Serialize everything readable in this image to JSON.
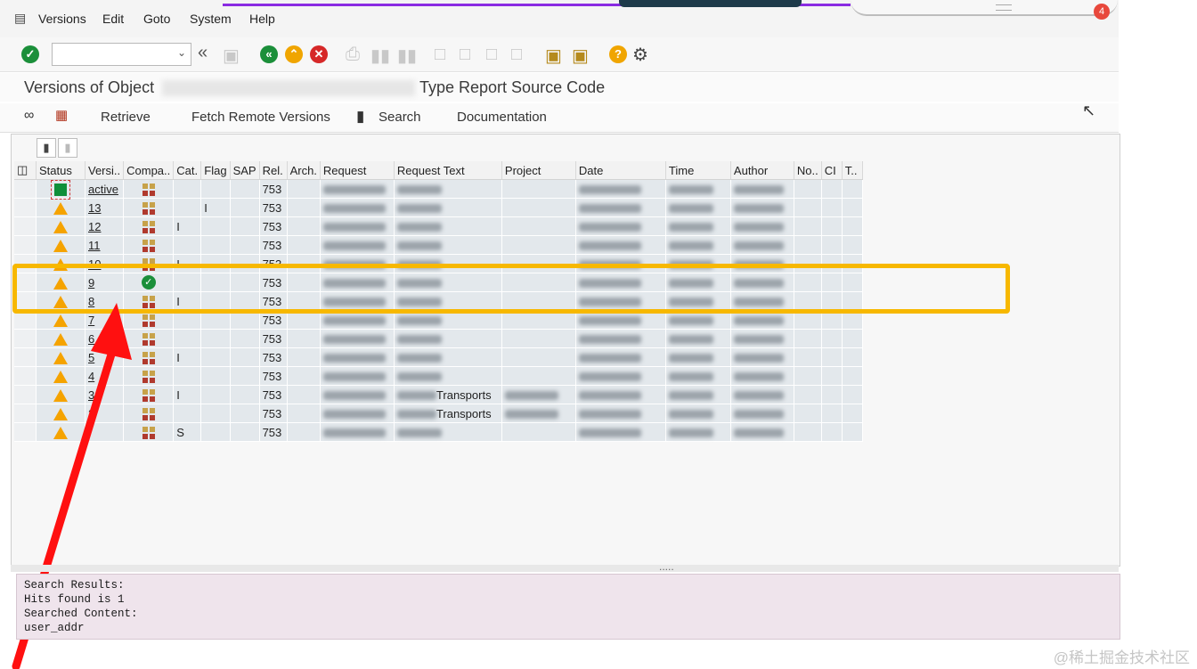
{
  "menu": {
    "items": [
      "Versions",
      "Edit",
      "Goto",
      "System",
      "Help"
    ]
  },
  "notification_count": "4",
  "toolbar": {
    "command_value": ""
  },
  "title": {
    "left": "Versions of Object",
    "right": "Type Report Source Code"
  },
  "app_toolbar": {
    "retrieve": "Retrieve",
    "fetch_remote": "Fetch Remote Versions",
    "search": "Search",
    "documentation": "Documentation"
  },
  "columns": [
    "Status",
    "Versi..",
    "Compa..",
    "Cat.",
    "Flag",
    "SAP",
    "Rel.",
    "Arch.",
    "Request",
    "Request Text",
    "Project",
    "Date",
    "Time",
    "Author",
    "No..",
    "CI",
    "T.."
  ],
  "rows": [
    {
      "status": "active-square",
      "version": "active",
      "compare": "compare-icon",
      "cat": "",
      "flag": "",
      "rel": "753",
      "req_text": ""
    },
    {
      "status": "warning",
      "version": "13",
      "compare": "compare-icon",
      "cat": "",
      "flag": "I",
      "rel": "753",
      "req_text": ""
    },
    {
      "status": "warning",
      "version": "12",
      "compare": "compare-icon",
      "cat": "I",
      "flag": "",
      "rel": "753",
      "req_text": ""
    },
    {
      "status": "warning",
      "version": "11",
      "compare": "compare-icon",
      "cat": "",
      "flag": "",
      "rel": "753",
      "req_text": ""
    },
    {
      "status": "warning",
      "version": "10",
      "compare": "compare-icon",
      "cat": "I",
      "flag": "",
      "rel": "753",
      "req_text": ""
    },
    {
      "status": "warning",
      "version": "9",
      "compare": "ok",
      "cat": "",
      "flag": "",
      "rel": "753",
      "req_text": ""
    },
    {
      "status": "warning",
      "version": "8",
      "compare": "compare-icon",
      "cat": "I",
      "flag": "",
      "rel": "753",
      "req_text": ""
    },
    {
      "status": "warning",
      "version": "7",
      "compare": "compare-icon",
      "cat": "",
      "flag": "",
      "rel": "753",
      "req_text": ""
    },
    {
      "status": "warning",
      "version": "6",
      "compare": "compare-icon",
      "cat": "",
      "flag": "",
      "rel": "753",
      "req_text": ""
    },
    {
      "status": "warning",
      "version": "5",
      "compare": "compare-icon",
      "cat": "I",
      "flag": "",
      "rel": "753",
      "req_text": ""
    },
    {
      "status": "warning",
      "version": "4",
      "compare": "compare-icon",
      "cat": "",
      "flag": "",
      "rel": "753",
      "req_text": ""
    },
    {
      "status": "warning",
      "version": "3",
      "compare": "compare-icon",
      "cat": "I",
      "flag": "",
      "rel": "753",
      "req_text": "Transports"
    },
    {
      "status": "warning",
      "version": "2",
      "compare": "compare-icon",
      "cat": "",
      "flag": "",
      "rel": "753",
      "req_text": "Transports"
    },
    {
      "status": "warning",
      "version": "",
      "compare": "compare-icon",
      "cat": "S",
      "flag": "",
      "rel": "753",
      "req_text": ""
    }
  ],
  "log": [
    "Search Results:",
    "Hits found is 1",
    "Searched Content:",
    "user_addr"
  ],
  "watermark": "@稀土掘金技术社区",
  "colors": {
    "highlight": "#f7b800",
    "annotation_arrow": "#ff1010",
    "warning": "#f5a300",
    "ok": "#1b8f3a"
  }
}
